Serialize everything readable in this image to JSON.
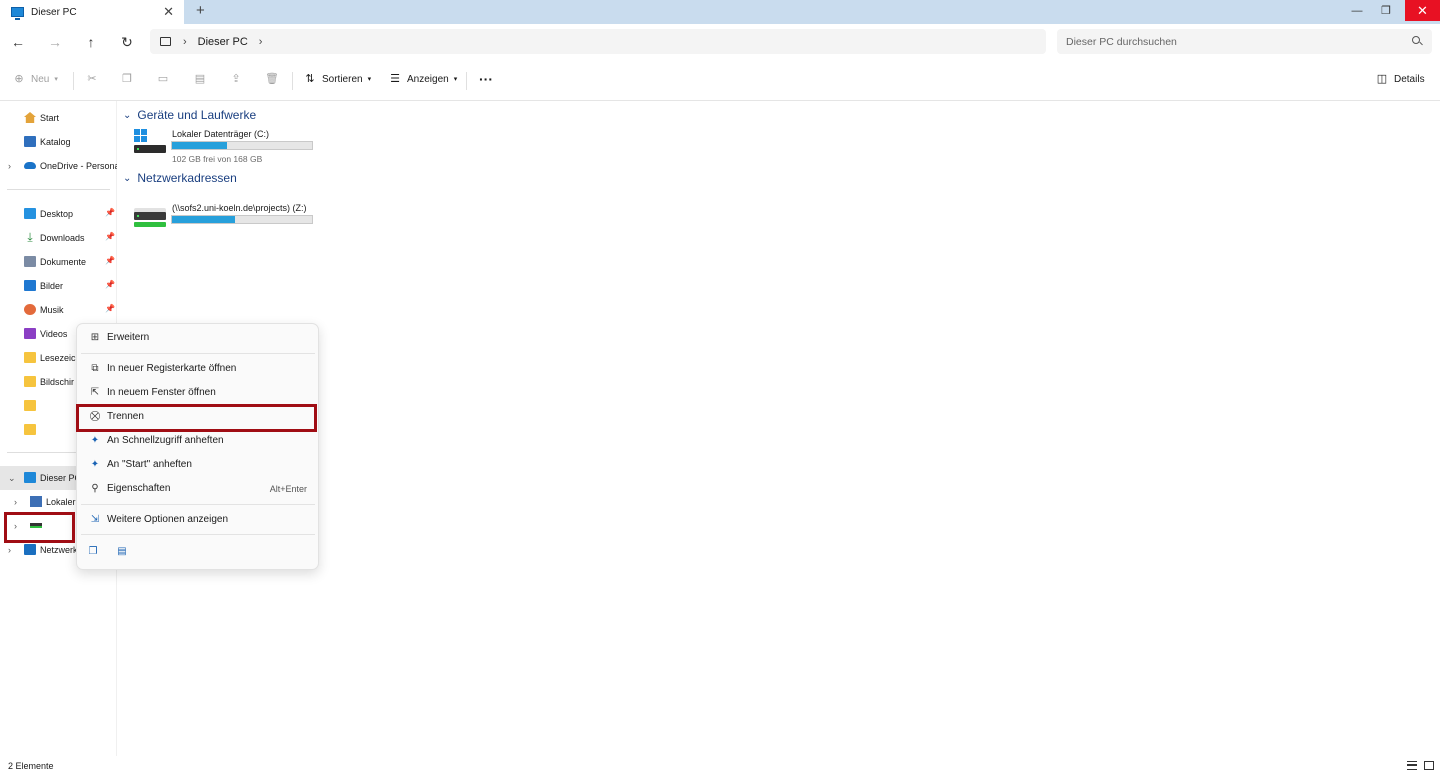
{
  "window": {
    "tab_title": "Dieser PC",
    "tab_close": "✕",
    "new_tab": "+",
    "minimize": "—",
    "maximize": "❐",
    "close": "✕"
  },
  "addressbar": {
    "crumb": "Dieser PC",
    "search_placeholder": "Dieser PC durchsuchen"
  },
  "commandbar": {
    "new_label": "Neu",
    "sort_label": "Sortieren",
    "view_label": "Anzeigen",
    "more_label": "···",
    "details_label": "Details"
  },
  "sidebar": {
    "items": [
      {
        "label": "Start",
        "icon": "home-icon"
      },
      {
        "label": "Katalog",
        "icon": "gallery-icon"
      },
      {
        "label": "OneDrive - Persona",
        "icon": "onedrive-icon"
      },
      {
        "label": "Desktop",
        "icon": "desktop-icon"
      },
      {
        "label": "Downloads",
        "icon": "download-icon"
      },
      {
        "label": "Dokumente",
        "icon": "documents-icon"
      },
      {
        "label": "Bilder",
        "icon": "pictures-icon"
      },
      {
        "label": "Musik",
        "icon": "music-icon"
      },
      {
        "label": "Videos",
        "icon": "videos-icon"
      },
      {
        "label": "Lesezeic",
        "icon": "folder-icon"
      },
      {
        "label": "Bildschir",
        "icon": "folder-icon"
      },
      {
        "label": "",
        "icon": "folder-icon"
      },
      {
        "label": "",
        "icon": "folder-icon"
      },
      {
        "label": "Dieser PC",
        "icon": "pc-icon"
      },
      {
        "label": "Lokaler",
        "icon": "local-disk-icon"
      },
      {
        "label": "",
        "icon": "network-drive-icon"
      },
      {
        "label": "Netzwerk",
        "icon": "network-icon"
      }
    ]
  },
  "main": {
    "section_drives": "Geräte und Laufwerke",
    "section_network": "Netzwerkadressen",
    "drives": [
      {
        "name": "Lokaler Datenträger (C:)",
        "free": "102 GB frei von 168 GB",
        "used_fraction": 0.39
      },
      {
        "name": "(\\\\sofs2.uni-koeln.de\\projects) (Z:)",
        "free": "",
        "used_fraction": 0.45
      }
    ]
  },
  "context_menu": {
    "items": [
      {
        "label": "Erweitern",
        "icon": "expand-icon",
        "shortcut": ""
      },
      {
        "label": "In neuer Registerkarte öffnen",
        "icon": "new-tab-icon",
        "shortcut": ""
      },
      {
        "label": "In neuem Fenster öffnen",
        "icon": "new-window-icon",
        "shortcut": ""
      },
      {
        "label": "Trennen",
        "icon": "disconnect-icon",
        "shortcut": ""
      },
      {
        "label": "An Schnellzugriff anheften",
        "icon": "pin-icon",
        "shortcut": ""
      },
      {
        "label": "An \"Start\" anheften",
        "icon": "pin-icon",
        "shortcut": ""
      },
      {
        "label": "Eigenschaften",
        "icon": "properties-icon",
        "shortcut": "Alt+Enter"
      },
      {
        "label": "Weitere Optionen anzeigen",
        "icon": "more-options-icon",
        "shortcut": ""
      }
    ]
  },
  "statusbar": {
    "item_count": "2 Elemente"
  },
  "colors": {
    "accent": "#1e88d8",
    "highlight": "#a00d14",
    "progress": "#27a0db"
  }
}
